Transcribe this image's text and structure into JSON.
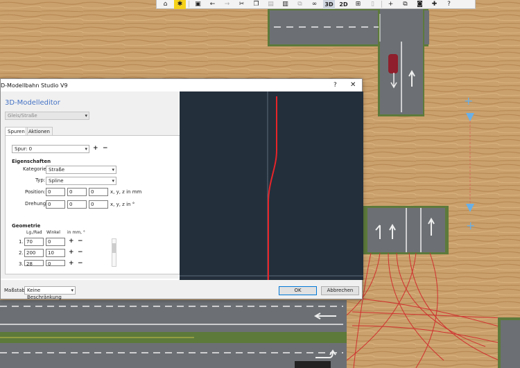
{
  "toolbar": {
    "items": [
      {
        "name": "home-icon",
        "glyph": "⌂"
      },
      {
        "name": "tools-icon",
        "glyph": "✱"
      },
      {
        "name": "save-icon",
        "glyph": "▣"
      },
      {
        "name": "undo-icon",
        "glyph": "←"
      },
      {
        "name": "redo-icon",
        "glyph": "→"
      },
      {
        "name": "cut-icon",
        "glyph": "✂"
      },
      {
        "name": "copy-icon",
        "glyph": "❐"
      },
      {
        "name": "paste-icon",
        "glyph": "▤"
      },
      {
        "name": "delete-icon",
        "glyph": "▥"
      },
      {
        "name": "duplicate-icon",
        "glyph": "⧉"
      },
      {
        "name": "link-icon",
        "glyph": "∞"
      },
      {
        "name": "view-3d",
        "glyph": "3D"
      },
      {
        "name": "view-2d",
        "glyph": "2D"
      },
      {
        "name": "grid-icon",
        "glyph": "⊞"
      },
      {
        "name": "lock-icon",
        "glyph": "▯"
      },
      {
        "name": "add-icon",
        "glyph": "+"
      },
      {
        "name": "layers-icon",
        "glyph": "⧉"
      },
      {
        "name": "camera-icon",
        "glyph": "◙"
      },
      {
        "name": "plugin-icon",
        "glyph": "✚"
      },
      {
        "name": "help-icon",
        "glyph": "?"
      }
    ]
  },
  "dialog": {
    "title": "D-Modellbahn Studio V9",
    "help": "?",
    "close": "✕",
    "heading": "3D-Modelleditor",
    "track_type": "Gleis/Straße",
    "tabs": [
      "Spuren",
      "Aktionen"
    ],
    "spur": "Spur: 0",
    "add": "+",
    "remove": "−",
    "eigenschaften": "Eigenschaften",
    "kategorie_label": "Kategorie:",
    "kategorie_value": "Straße",
    "typ_label": "Typ:",
    "typ_value": "Spline",
    "position_label": "Position:",
    "position_values": [
      "0",
      "0",
      "0"
    ],
    "position_unit": "x, y, z in mm",
    "drehung_label": "Drehung:",
    "drehung_values": [
      "0",
      "0",
      "0"
    ],
    "drehung_unit": "x, y, z in °",
    "geometrie": "Geometrie",
    "col_lg": "Lg./Rad",
    "col_winkel": "Winkel",
    "col_unit": "in mm, °",
    "rows": [
      {
        "idx": "1.",
        "lg": "70",
        "winkel": "0"
      },
      {
        "idx": "2.",
        "lg": "200",
        "winkel": "10"
      },
      {
        "idx": "3.",
        "lg": "28",
        "winkel": "0"
      }
    ],
    "massstab_label": "Maßstab:",
    "massstab_value": "Keine Beschränkung",
    "ok": "OK",
    "cancel": "Abbrechen"
  },
  "colors": {
    "accent": "#4472c4",
    "toolbar_active": "#f6d21b",
    "preview_bg": "#232f3b",
    "spline": "#e8242a",
    "wood": "#c9a06d"
  }
}
